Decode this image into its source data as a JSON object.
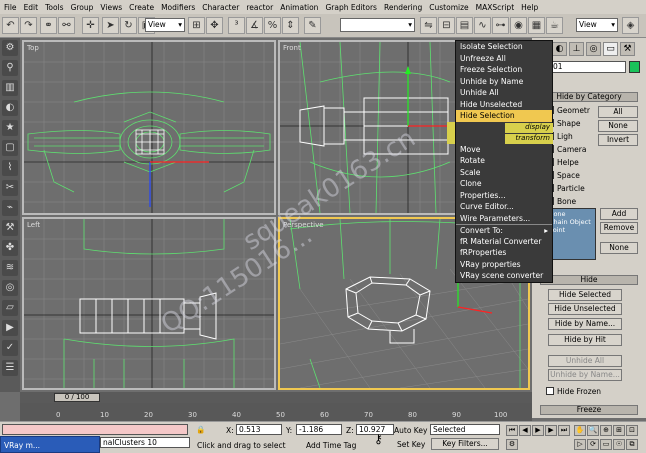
{
  "menubar": {
    "items": [
      "File",
      "Edit",
      "Tools",
      "Group",
      "Views",
      "Create",
      "Modifiers",
      "Character",
      "reactor",
      "Animation",
      "Graph Editors",
      "Rendering",
      "Customize",
      "MAXScript",
      "Help"
    ]
  },
  "toolbar": {
    "refcoord_value": "View",
    "refcoord_value2": "View"
  },
  "viewports": {
    "top_label": "Top",
    "front_label": "Front",
    "left_label": "Left",
    "perspective_label": "Perspective"
  },
  "watermark": {
    "line1": "squeak0163.cn",
    "line2": "QQ:115016..."
  },
  "quad_menu": {
    "display_label": "display",
    "transform_label": "transform",
    "items": [
      {
        "label": "Isolate Selection",
        "highlight": false
      },
      {
        "label": "Unfreeze All",
        "highlight": false
      },
      {
        "label": "Freeze Selection",
        "highlight": false
      },
      {
        "label": "Unhide by Name",
        "highlight": false
      },
      {
        "label": "Unhide All",
        "highlight": false
      },
      {
        "label": "Hide Unselected",
        "highlight": false
      },
      {
        "label": "Hide Selection",
        "highlight": true
      },
      {
        "label": "Move",
        "highlight": false,
        "sep": true
      },
      {
        "label": "Rotate",
        "highlight": false
      },
      {
        "label": "Scale",
        "highlight": false
      },
      {
        "label": "Clone",
        "highlight": false
      },
      {
        "label": "Properties...",
        "highlight": false
      },
      {
        "label": "Curve Editor...",
        "highlight": false
      },
      {
        "label": "Wire Parameters...",
        "highlight": false
      },
      {
        "label": "Convert To:",
        "highlight": false,
        "arrow": true
      },
      {
        "label": "fR Material Converter",
        "highlight": false
      },
      {
        "label": "fRProperties",
        "highlight": false
      },
      {
        "label": "VRay properties",
        "highlight": false
      },
      {
        "label": "VRay scene converter",
        "highlight": false
      }
    ]
  },
  "command_panel": {
    "object_name": "Box01",
    "hide_by_category_header": "Hide by Category",
    "categories": [
      {
        "label": "Geometr",
        "checked": false
      },
      {
        "label": "Shape",
        "checked": false
      },
      {
        "label": "Ligh",
        "checked": false
      },
      {
        "label": "Camera",
        "checked": false
      },
      {
        "label": "Helpe",
        "checked": false
      },
      {
        "label": "Space",
        "checked": false
      },
      {
        "label": "Particle",
        "checked": false
      },
      {
        "label": "Bone",
        "checked": false
      }
    ],
    "all_button": "All",
    "none_button": "None",
    "invert_button": "Invert",
    "list_items": [
      "Bone",
      "Chain Object",
      "Point"
    ],
    "add_button": "Add",
    "remove_button": "Remove",
    "none_button2": "None",
    "hide_header": "Hide",
    "hide_selected": "Hide Selected",
    "hide_unselected": "Hide Unselected",
    "hide_by_name": "Hide by Name...",
    "hide_by_hit": "Hide by Hit",
    "unhide_all": "Unhide All",
    "unhide_by_name": "Unhide by Name...",
    "hide_frozen": "Hide Frozen",
    "freeze_header": "Freeze"
  },
  "timeline": {
    "slider_text": "0 / 100",
    "ticks": [
      "0",
      "10",
      "20",
      "30",
      "40",
      "50",
      "60",
      "70",
      "80",
      "90",
      "100"
    ]
  },
  "status": {
    "taskbar_label": "VRay m...",
    "script_text": "nalClusters 10",
    "x_label": "X:",
    "x_value": "0.513",
    "y_label": "Y:",
    "y_value": "-1.186",
    "z_label": "Z:",
    "z_value": "10.927",
    "prompt": "Click and drag to select",
    "add_time_tag": "Add Time Tag",
    "auto_key": "Auto Key",
    "selected": "Selected",
    "set_key": "Set Key",
    "key_filters": "Key Filters..."
  },
  "colors": {
    "viewport_bg": "#6e6e6e",
    "wire_green": "#5ee070",
    "wire_white": "#ffffff",
    "highlight": "#f0c850"
  }
}
